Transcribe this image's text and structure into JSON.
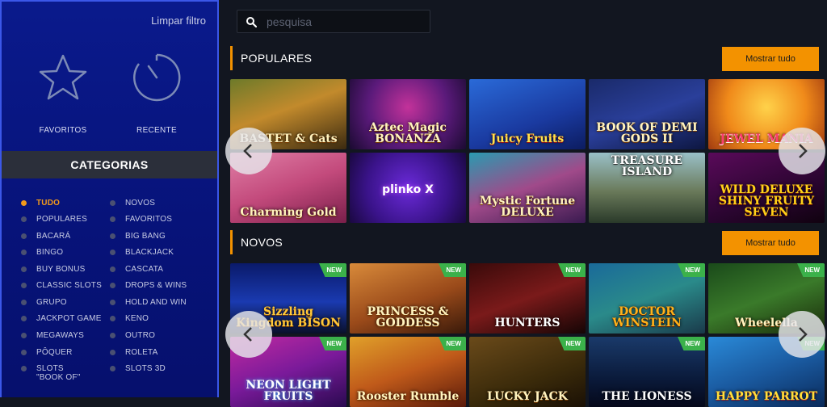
{
  "sidebar": {
    "clear_filter": "Limpar filtro",
    "favorites_label": "FAVORITOS",
    "recent_label": "RECENTE",
    "categories_header": "CATEGORIAS",
    "categories": [
      {
        "label": "TUDO",
        "active": true
      },
      {
        "label": "NOVOS",
        "active": false
      },
      {
        "label": "POPULARES",
        "active": false
      },
      {
        "label": "FAVORITOS",
        "active": false
      },
      {
        "label": "BACARÁ",
        "active": false
      },
      {
        "label": "BIG BANG",
        "active": false
      },
      {
        "label": "BINGO",
        "active": false
      },
      {
        "label": "BLACKJACK",
        "active": false
      },
      {
        "label": "BUY BONUS",
        "active": false
      },
      {
        "label": "CASCATA",
        "active": false
      },
      {
        "label": "CLASSIC SLOTS",
        "active": false
      },
      {
        "label": "DROPS & WINS",
        "active": false
      },
      {
        "label": "GRUPO",
        "active": false
      },
      {
        "label": "HOLD AND WIN",
        "active": false
      },
      {
        "label": "JACKPOT GAME",
        "active": false
      },
      {
        "label": "KENO",
        "active": false
      },
      {
        "label": "MEGAWAYS",
        "active": false
      },
      {
        "label": "OUTRO",
        "active": false
      },
      {
        "label": "PÔQUER",
        "active": false
      },
      {
        "label": "ROLETA",
        "active": false
      },
      {
        "label": "SLOTS \"BOOK OF\"",
        "active": false
      },
      {
        "label": "SLOTS 3D",
        "active": false
      }
    ]
  },
  "search": {
    "placeholder": "pesquisa",
    "value": ""
  },
  "sections": [
    {
      "title": "POPULARES",
      "show_all": "Mostrar tudo",
      "games": [
        {
          "name": "BASTET & Cats",
          "new": false
        },
        {
          "name": "Aztec Magic BONANZA",
          "new": false
        },
        {
          "name": "Juicy Fruits",
          "new": false
        },
        {
          "name": "BOOK OF DEMI GODS II",
          "new": false
        },
        {
          "name": "JEWEL MANIA",
          "new": false
        },
        {
          "name": "Charming Gold",
          "new": false
        },
        {
          "name": "plinko X",
          "new": false
        },
        {
          "name": "Mystic Fortune DELUXE",
          "new": false
        },
        {
          "name": "TREASURE ISLAND",
          "new": false
        },
        {
          "name": "WILD DELUXE SHINY FRUITY SEVEN",
          "new": false
        }
      ]
    },
    {
      "title": "NOVOS",
      "show_all": "Mostrar tudo",
      "badge": "NEW",
      "games": [
        {
          "name": "Sizzling Kingdom BISON",
          "new": true
        },
        {
          "name": "PRINCESS & GODDESS",
          "new": true
        },
        {
          "name": "HUNTERS",
          "new": true
        },
        {
          "name": "DOCTOR WINSTEIN",
          "new": true
        },
        {
          "name": "Wheelella",
          "new": true
        },
        {
          "name": "NEON LIGHT FRUITS",
          "new": true
        },
        {
          "name": "Rooster Rumble",
          "new": true
        },
        {
          "name": "LUCKY JACK",
          "new": true
        },
        {
          "name": "THE LIONESS",
          "new": true
        },
        {
          "name": "HAPPY PARROT",
          "new": true
        }
      ]
    }
  ],
  "colors": {
    "accent": "#f39200",
    "sidebar_bg": "#0a1a8c",
    "main_bg": "#121620",
    "new_badge": "#3bb14a"
  },
  "icons": {
    "favorites": "star-icon",
    "recent": "clock-icon",
    "search": "search-icon",
    "prev": "chevron-left-icon",
    "next": "chevron-right-icon"
  }
}
